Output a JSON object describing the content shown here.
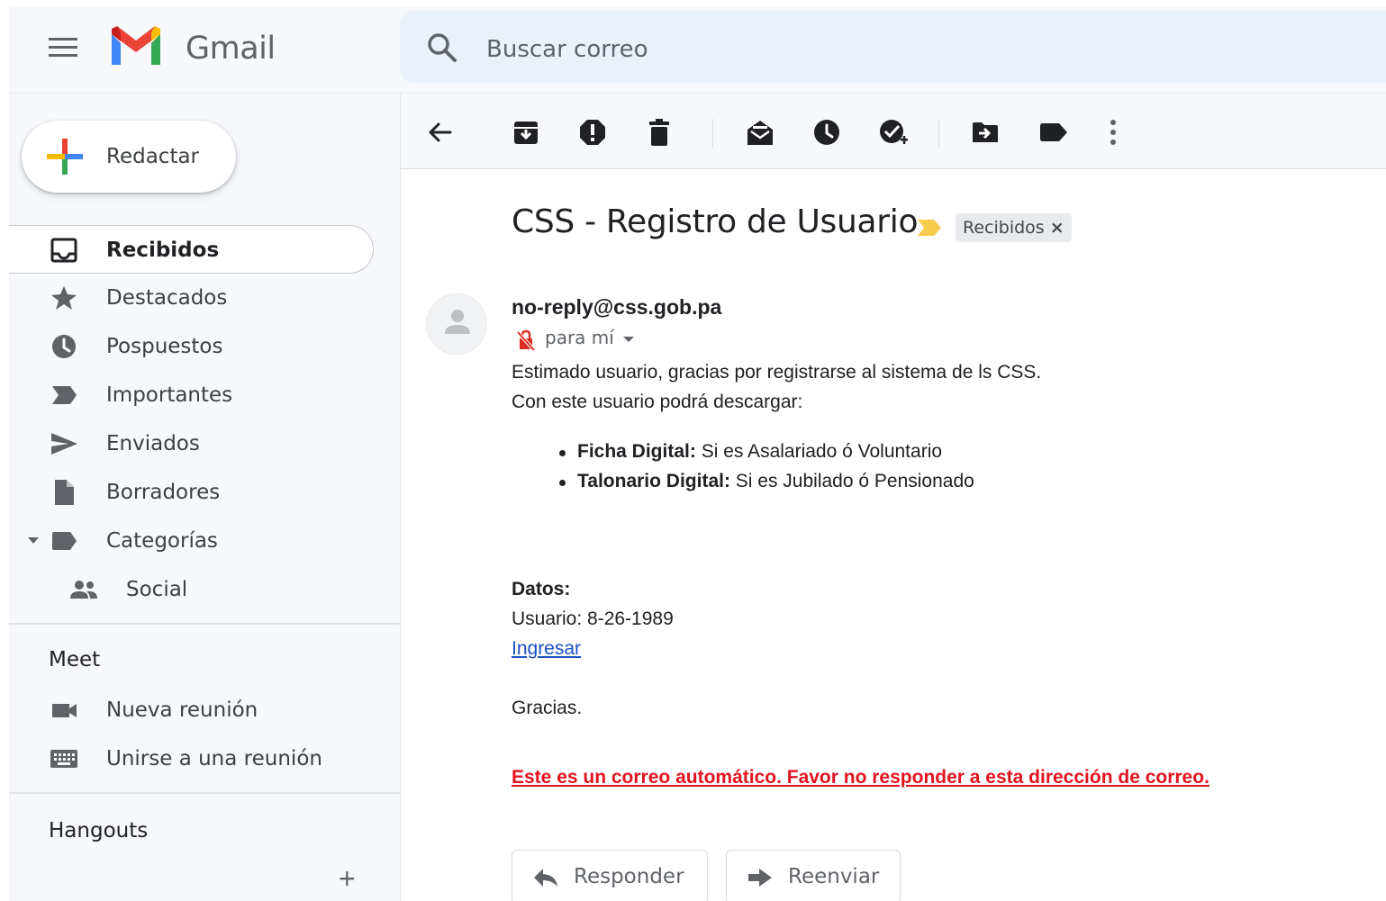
{
  "header": {
    "brand": "Gmail",
    "search_placeholder": "Buscar correo"
  },
  "sidebar": {
    "compose_label": "Redactar",
    "items": [
      {
        "label": "Recibidos",
        "icon": "inbox-icon",
        "active": true
      },
      {
        "label": "Destacados",
        "icon": "star-icon"
      },
      {
        "label": "Pospuestos",
        "icon": "clock-icon"
      },
      {
        "label": "Importantes",
        "icon": "important-icon"
      },
      {
        "label": "Enviados",
        "icon": "send-icon"
      },
      {
        "label": "Borradores",
        "icon": "draft-icon"
      },
      {
        "label": "Categorías",
        "icon": "label-icon"
      },
      {
        "label": "Social",
        "icon": "people-icon"
      }
    ],
    "meet": {
      "title": "Meet",
      "items": [
        {
          "label": "Nueva reunión",
          "icon": "video-camera-icon"
        },
        {
          "label": "Unirse a una reunión",
          "icon": "keyboard-icon"
        }
      ]
    },
    "hangouts": {
      "title": "Hangouts",
      "add": "+"
    }
  },
  "email": {
    "subject": "CSS - Registro de Usuario",
    "label_chip": "Recibidos",
    "sender": "no-reply@css.gob.pa",
    "to": "para mí",
    "body": {
      "greeting": "Estimado usuario, gracias por registrarse al sistema de ls CSS.",
      "intro": "Con este usuario podrá descargar:",
      "bullets": [
        {
          "bold": "Ficha Digital:",
          "text": " Si es Asalariado ó Voluntario"
        },
        {
          "bold": "Talonario Digital:",
          "text": " Si es Jubilado ó Pensionado"
        }
      ],
      "data_title": "Datos:",
      "user_line": "Usuario: 8-26-1989",
      "link": "Ingresar",
      "thanks": "Gracias.",
      "warning": "Este es un correo automático. Favor no responder a esta dirección de correo."
    },
    "actions": {
      "reply": "Responder",
      "forward": "Reenviar"
    }
  },
  "colors": {
    "accent_red": "#e3131f",
    "link_blue": "#1a4fc4",
    "importance_yellow": "#f7cb4d"
  }
}
